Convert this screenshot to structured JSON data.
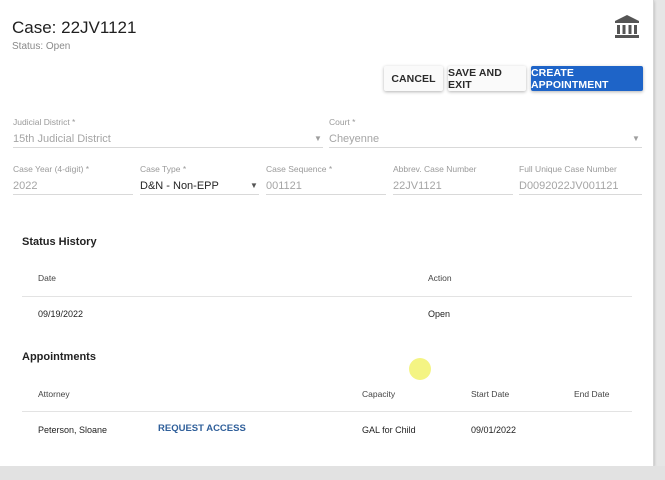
{
  "header": {
    "title": "Case: 22JV1121",
    "status_label": "Status: ",
    "status_value": "Open",
    "icon": "courthouse-icon"
  },
  "actions": {
    "cancel": "CANCEL",
    "save_exit": "SAVE AND EXIT",
    "create_appointment": "CREATE APPOINTMENT"
  },
  "form": {
    "judicial_district": {
      "label": "Judicial District *",
      "value": "15th Judicial District"
    },
    "court": {
      "label": "Court *",
      "value": "Cheyenne"
    },
    "case_year": {
      "label": "Case Year (4-digit) *",
      "value": "2022"
    },
    "case_type": {
      "label": "Case Type *",
      "value": "D&N - Non-EPP"
    },
    "case_sequence": {
      "label": "Case Sequence *",
      "value": "001121"
    },
    "abbrev_case_number": {
      "label": "Abbrev. Case Number",
      "value": "22JV1121"
    },
    "full_unique_case_number": {
      "label": "Full Unique Case Number",
      "value": "D0092022JV001121"
    }
  },
  "status_history": {
    "title": "Status History",
    "columns": [
      "Date",
      "Action"
    ],
    "rows": [
      {
        "date": "09/19/2022",
        "action": "Open"
      }
    ]
  },
  "appointments": {
    "title": "Appointments",
    "columns": [
      "Attorney",
      "Capacity",
      "Start Date",
      "End Date"
    ],
    "rows": [
      {
        "attorney": "Peterson, Sloane",
        "link": "REQUEST ACCESS",
        "capacity": "GAL for Child",
        "start_date": "09/01/2022",
        "end_date": ""
      }
    ]
  },
  "colors": {
    "primary": "#1e64c8",
    "link": "#2f5f9a"
  }
}
